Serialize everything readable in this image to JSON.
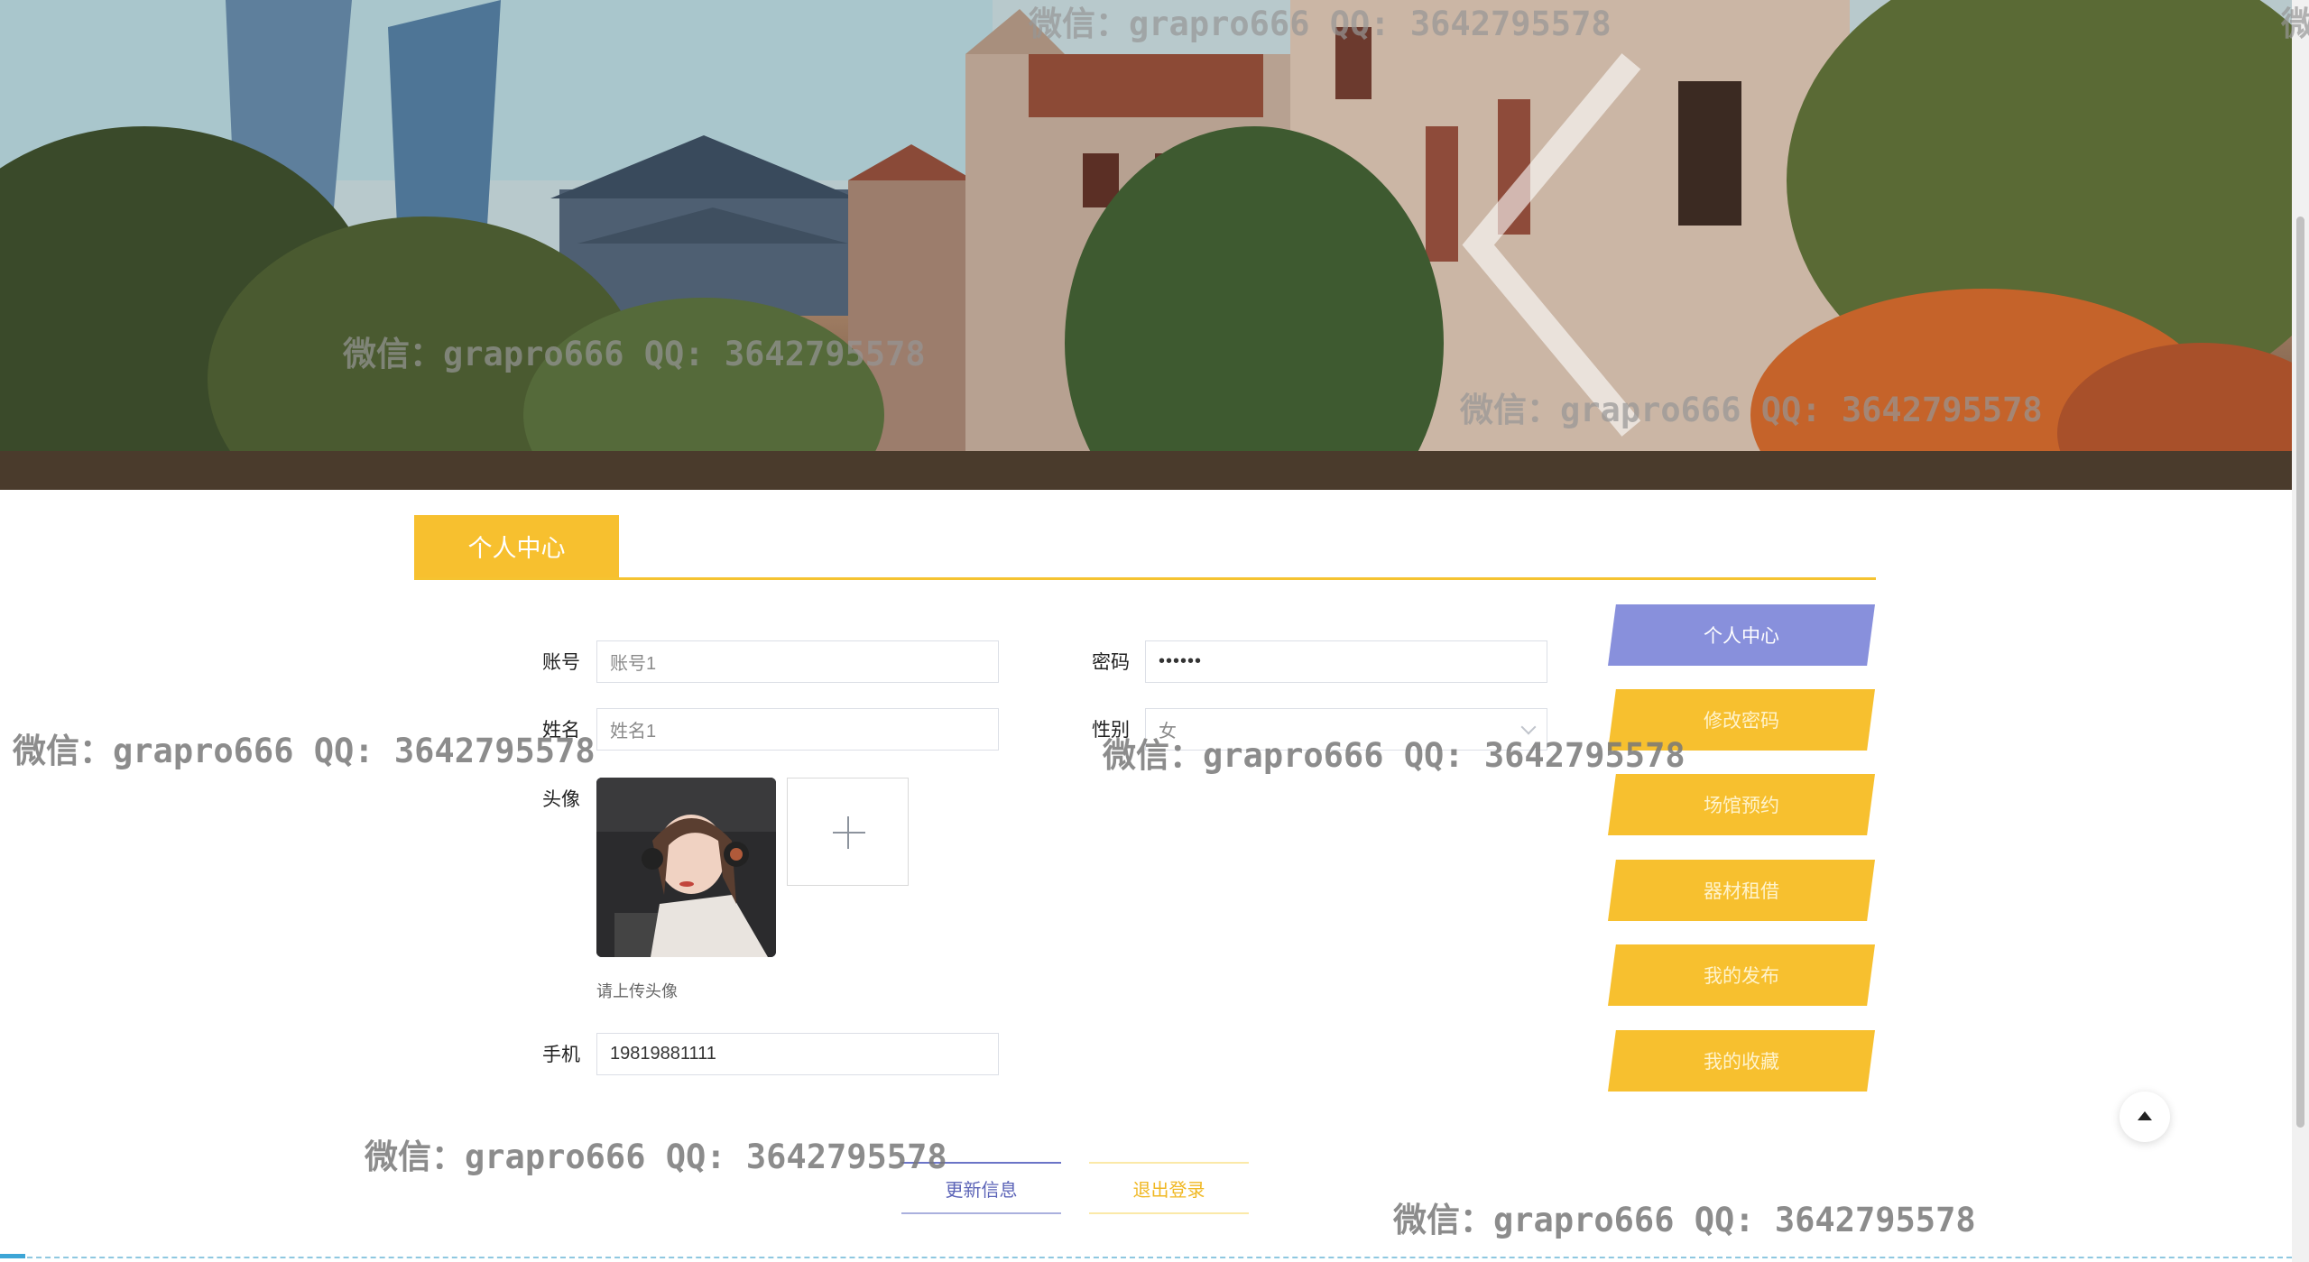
{
  "banner": {
    "prev_icon": "chevron-left-icon",
    "next_icon": "chevron-right-icon"
  },
  "tabs": {
    "active_label": "个人中心"
  },
  "form": {
    "account_label": "账号",
    "account_value": "账号1",
    "password_label": "密码",
    "password_value": "••••••",
    "name_label": "姓名",
    "name_value": "姓名1",
    "gender_label": "性别",
    "gender_value": "女",
    "avatar_label": "头像",
    "upload_hint": "请上传头像",
    "phone_label": "手机",
    "phone_value": "19819881111"
  },
  "side_menu": [
    {
      "label": "个人中心"
    },
    {
      "label": "修改密码"
    },
    {
      "label": "场馆预约"
    },
    {
      "label": "器材租借"
    },
    {
      "label": "我的发布"
    },
    {
      "label": "我的收藏"
    }
  ],
  "actions": {
    "update_label": "更新信息",
    "logout_label": "退出登录"
  },
  "watermarks": [
    "微信：grapro666 QQ: 3642795578",
    "微信：grapro666 QQ: 3642795578",
    "微信：grapro666 QQ: 3642795578",
    "微信：grapro666 QQ: 3642795578",
    "微信：grapro666 QQ: 3642795578",
    "微信：grapro666 QQ: 3642795578",
    "微信：grapro666 QQ: 3642795578",
    "微"
  ],
  "colors": {
    "accent_yellow": "#f7c02f",
    "accent_purple": "#8890dc"
  }
}
